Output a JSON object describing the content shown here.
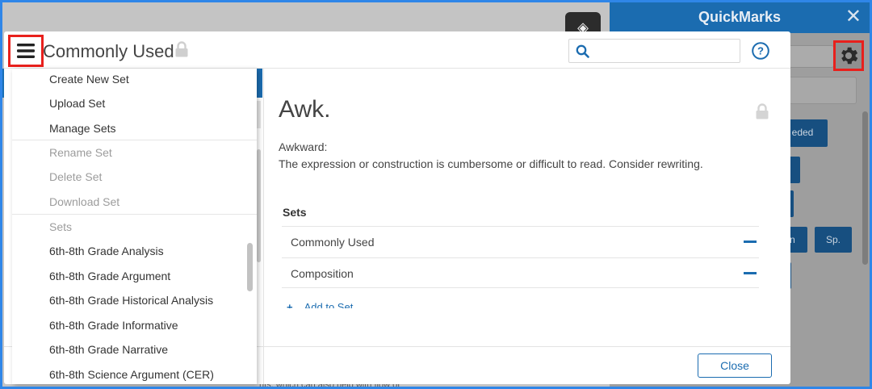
{
  "quickmarks": {
    "title": "QuickMarks",
    "close_glyph": "✕",
    "buttons": [
      {
        "label": "eded"
      },
      {
        "label": ""
      },
      {
        "label": ""
      },
      {
        "label": "n"
      },
      {
        "label": "Sp."
      },
      {
        "label": ""
      }
    ]
  },
  "modal": {
    "title": "Commonly Used",
    "search": {
      "value": "",
      "placeholder": ""
    },
    "menu": {
      "items": [
        {
          "label": "Create New Set",
          "enabled": true
        },
        {
          "label": "Upload Set",
          "enabled": true
        },
        {
          "label": "Manage Sets",
          "enabled": true
        },
        {
          "label": "Rename Set",
          "enabled": false
        },
        {
          "label": "Delete Set",
          "enabled": false
        },
        {
          "label": "Download Set",
          "enabled": false
        }
      ],
      "section_label": "Sets",
      "sets": [
        "6th-8th Grade Analysis",
        "6th-8th Grade Argument",
        "6th-8th Grade Historical Analysis",
        "6th-8th Grade Informative",
        "6th-8th Grade Narrative",
        "6th-8th Science Argument (CER)"
      ]
    },
    "mark": {
      "title": "Awk.",
      "label": "Awkward:",
      "description": "The expression or construction is cumbersome or difficult to read. Consider rewriting."
    },
    "sets_heading": "Sets",
    "assigned_sets": [
      "Commonly Used",
      "Composition"
    ],
    "add_to_set_label": "Add to Set",
    "close_label": "Close"
  },
  "background": {
    "footer_text": "nts, which can also help with flow of"
  },
  "colors": {
    "accent": "#1b6cb0",
    "highlight": "#e8201c",
    "frame": "#2f86e8"
  }
}
